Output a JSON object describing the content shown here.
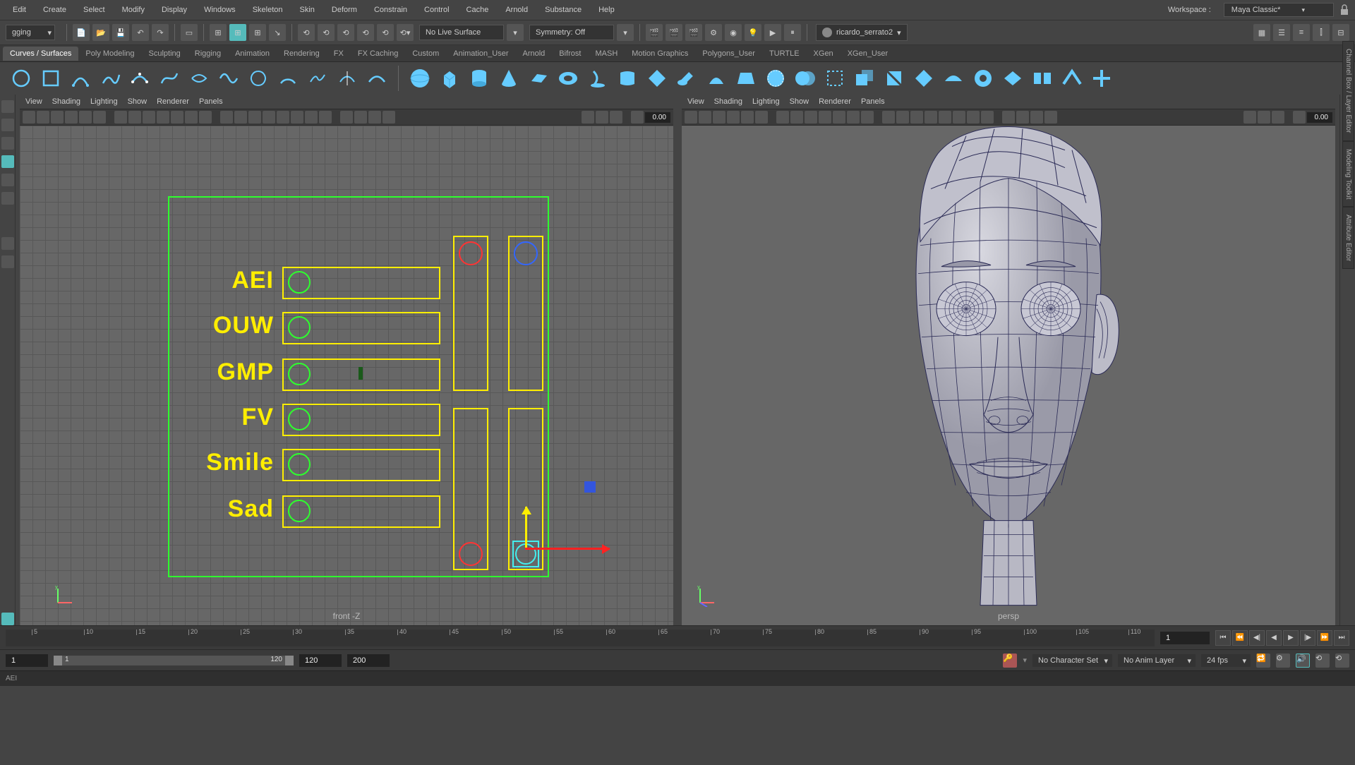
{
  "menu": [
    "Edit",
    "Create",
    "Select",
    "Modify",
    "Display",
    "Windows",
    "Skeleton",
    "Skin",
    "Deform",
    "Constrain",
    "Control",
    "Cache",
    "Arnold",
    "Substance",
    "Help"
  ],
  "workspace": {
    "label": "Workspace :",
    "value": "Maya Classic*"
  },
  "toolbar": {
    "module": "gging",
    "liveSurface": "No Live Surface",
    "symmetry": "Symmetry: Off",
    "user": "ricardo_serrato2"
  },
  "shelfTabs": [
    "Curves / Surfaces",
    "Poly Modeling",
    "Sculpting",
    "Rigging",
    "Animation",
    "Rendering",
    "FX",
    "FX Caching",
    "Custom",
    "Animation_User",
    "Arnold",
    "Bifrost",
    "MASH",
    "Motion Graphics",
    "Polygons_User",
    "TURTLE",
    "XGen",
    "XGen_User"
  ],
  "activeShelf": "Curves / Surfaces",
  "viewportMenu": [
    "View",
    "Shading",
    "Lighting",
    "Show",
    "Renderer",
    "Panels"
  ],
  "viewportField": "0.00",
  "leftCamera": "front -Z",
  "rightCamera": "persp",
  "rightTabs": [
    "Channel Box / Layer Editor",
    "Modeling Toolkit",
    "Attribute Editor"
  ],
  "rigSliders": [
    "AEI",
    "OUW",
    "GMP",
    "FV",
    "Smile",
    "Sad"
  ],
  "timeSlider": {
    "ticks": [
      5,
      10,
      15,
      20,
      25,
      30,
      35,
      40,
      45,
      50,
      55,
      60,
      65,
      70,
      75,
      80,
      85,
      90,
      95,
      100,
      105,
      110
    ],
    "lastVisible": "1...",
    "current": "1"
  },
  "rangeSlider": {
    "start": "1",
    "rangeStart": "1",
    "rangeEnd": "120",
    "end1": "120",
    "end2": "200",
    "charSet": "No Character Set",
    "animLayer": "No Anim Layer",
    "fps": "24 fps"
  },
  "status": "AEI"
}
